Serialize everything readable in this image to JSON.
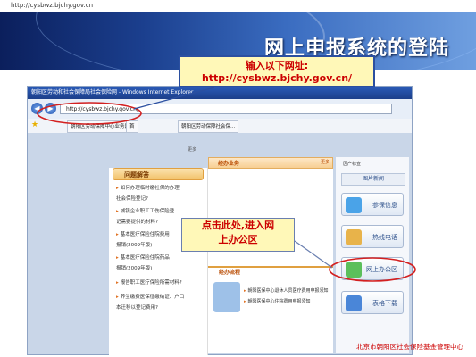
{
  "top_url": "http://cysbwz.bjchy.gov.cn",
  "banner": {
    "title": "网上申报系统的登陆"
  },
  "browser": {
    "window_title": "朝阳区劳动和社会保障局社会保险网 - Windows Internet Explorer",
    "address": "http://cysbwz.bjchy.gov.cn/",
    "tabs": [
      "朝阳区劳动保障中心业务网",
      "首",
      "朝阳区劳动保障社会保..."
    ]
  },
  "left_column": {
    "header": "问题解答",
    "more": "更多",
    "items": [
      "如何办理临时缴社保的办理",
      "社会保险登记?",
      "城镇企业职工工伤保险登",
      "记需要提供的材料?",
      "基本医疗保险住院费用",
      "报销(2009年版)",
      "基本医疗保险住院药品",
      "报销(2009年版)",
      "报告职工医疗保险所需材料?",
      "养生缴费医保征缴纳证、户口",
      "本迁移以登记费用?"
    ]
  },
  "center_column": {
    "biz_header": "经办业务",
    "biz_more": "更多",
    "guide_header": "经办流程",
    "guide_items": [
      "朝阳医保中心退休人员医疗费用申报须知",
      "朝阳医保中心住院费用申报须知"
    ]
  },
  "right_column": {
    "top_label": "区产标查",
    "news_tab": "图片新闻",
    "buttons": [
      "参保信息",
      "热线电话",
      "网上办公区",
      "表格下载"
    ]
  },
  "callouts": {
    "top_line1": "输入以下网址:",
    "top_line2": "http://cysbwz.bjchy.gov.cn/",
    "mid_line1": "点击此处,进入网",
    "mid_line2": "上办公区"
  },
  "footer": "北京市朝阳区社会保险基金管理中心",
  "colors": {
    "callout_bg": "#fff8b8",
    "callout_text": "#cc0000",
    "ellipse": "#d32020",
    "banner_dark": "#0b1f5c"
  }
}
